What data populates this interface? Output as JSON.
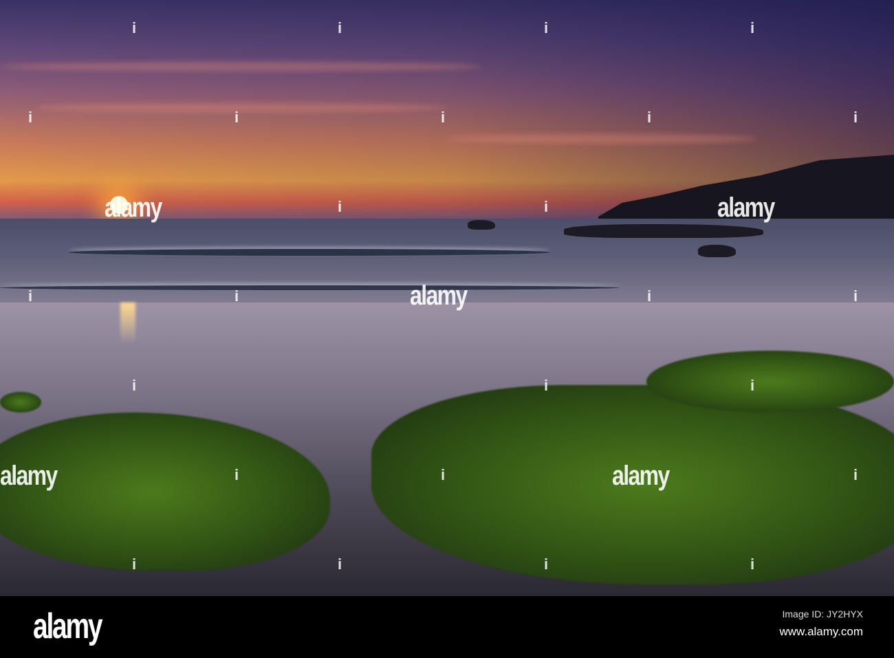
{
  "watermark": {
    "text": "alamy"
  },
  "footer": {
    "logo": "alamy",
    "image_id": "Image ID: JY2HYX",
    "url": "www.alamy.com"
  }
}
